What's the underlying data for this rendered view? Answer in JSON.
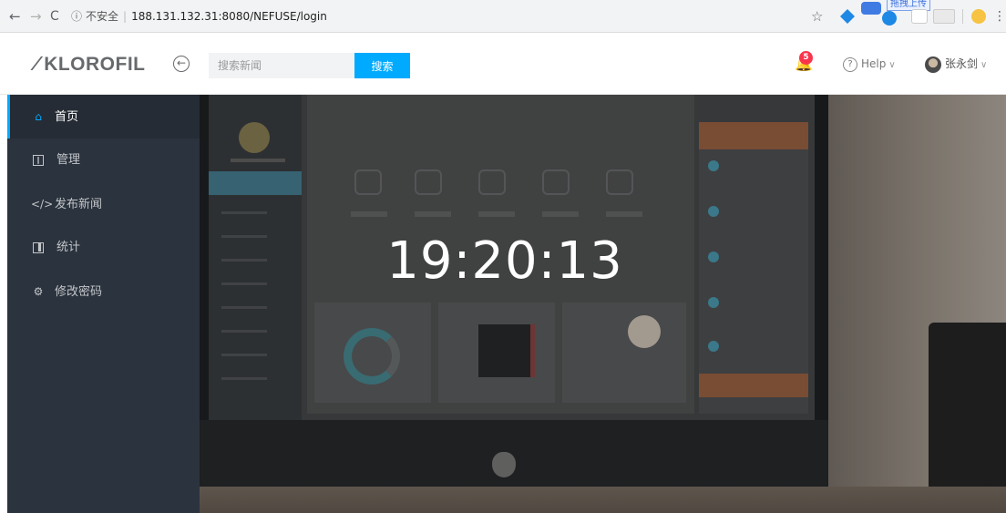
{
  "browser": {
    "back_glyph": "←",
    "forward_glyph": "→",
    "reload_glyph": "C",
    "info_glyph": "ⓘ",
    "security_label": "不安全",
    "url": "188.131.132.31:8080/NEFUSE/login",
    "star_glyph": "☆",
    "upload_label": "拖拽上传",
    "menu_glyph": "⋮"
  },
  "navbar": {
    "brand_icon": "leaf-icon",
    "brand": "KLOROFIL",
    "toggle_glyph": "←",
    "search_placeholder": "搜索新闻",
    "search_button": "搜索",
    "notification_count": "5",
    "help_label": "Help",
    "user_name": "张永剑"
  },
  "sidebar": {
    "items": [
      {
        "label": "首页",
        "icon": "home-icon",
        "active": true
      },
      {
        "label": "管理",
        "icon": "columns-icon",
        "active": false
      },
      {
        "label": "发布新闻",
        "icon": "code-icon",
        "active": false
      },
      {
        "label": "统计",
        "icon": "chart-icon",
        "active": false
      },
      {
        "label": "修改密码",
        "icon": "gear-icon",
        "active": false
      }
    ]
  },
  "main": {
    "clock": "19:20:13"
  },
  "colors": {
    "accent": "#00aaff",
    "sidebar_bg": "#2b333e",
    "badge": "#f9354c"
  }
}
